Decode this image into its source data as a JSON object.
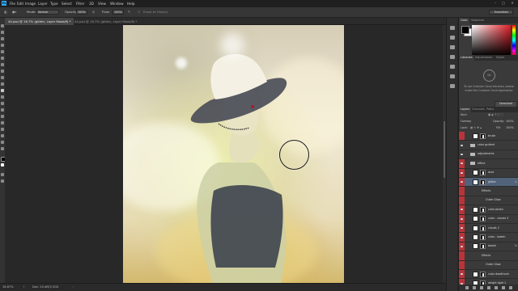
{
  "app": {
    "logo": "Ps",
    "accent": "#31a8ff"
  },
  "menu": [
    "File",
    "Edit",
    "Image",
    "Layer",
    "Type",
    "Select",
    "Filter",
    "3D",
    "View",
    "Window",
    "Help"
  ],
  "window_controls": [
    "–",
    "□",
    "✕"
  ],
  "options_bar": {
    "mode_label": "Mode:",
    "mode_value": "Normal",
    "opacity_label": "Opacity:",
    "opacity_value": "100%",
    "flow_label": "Flow:",
    "flow_value": "100%",
    "history_label": "Erase to History",
    "workspace": "Essentials"
  },
  "tabs": [
    {
      "label": "44.psd @ 16.7% (glitter, Layer Mask/8) *",
      "active": true
    },
    {
      "label": "44.psd @ 16.7% (glitter, Layer Mask/8) *",
      "active": false
    }
  ],
  "status": {
    "zoom": "16.67%",
    "doc": "Doc: 20.4M/2.50G"
  },
  "panels": {
    "color_tabs": [
      "Color",
      "Swatches"
    ],
    "library_tabs": [
      "Libraries",
      "Adjustments",
      "Styles"
    ],
    "cc_message": "To use Creative Cloud Libraries, please install the Creative Cloud Application",
    "cc_button": "Download",
    "layers_tabs": [
      "Layers",
      "Channels",
      "Paths"
    ],
    "kind_label": "Kind",
    "blend_mode": "Overlay",
    "opacity_label": "Opacity:",
    "opacity_value": "100%",
    "lock_label": "Lock:",
    "fill_label": "Fill:",
    "fill_value": "100%"
  },
  "layers": [
    {
      "name": "brush",
      "type": "layer",
      "eye": false,
      "red": true
    },
    {
      "name": "color grdient",
      "type": "group",
      "eye": true,
      "red": false
    },
    {
      "name": "adjustments",
      "type": "group",
      "eye": true,
      "red": false
    },
    {
      "name": "effect",
      "type": "group",
      "eye": true,
      "red": true
    },
    {
      "name": "dust",
      "type": "layer",
      "eye": true,
      "red": true
    },
    {
      "name": "glitter",
      "type": "layer",
      "eye": true,
      "red": true,
      "selected": true,
      "fx": "fx"
    },
    {
      "name": "Effects",
      "type": "sub",
      "eye": false,
      "red": true
    },
    {
      "name": "Outer Glow",
      "type": "sub2",
      "eye": false,
      "red": true
    },
    {
      "name": "color photo",
      "type": "layer",
      "eye": true,
      "red": true
    },
    {
      "name": "color - clouds 3",
      "type": "layer",
      "eye": true,
      "red": true
    },
    {
      "name": "clouds 2",
      "type": "layer",
      "eye": true,
      "red": true
    },
    {
      "name": "color - bokeh",
      "type": "layer",
      "eye": true,
      "red": true
    },
    {
      "name": "bokeh",
      "type": "layer",
      "eye": true,
      "red": true,
      "fx": "fx"
    },
    {
      "name": "Effects",
      "type": "sub",
      "eye": false,
      "red": true
    },
    {
      "name": "Outer Glow",
      "type": "sub2",
      "eye": false,
      "red": true
    },
    {
      "name": "color deadtrunk",
      "type": "layer",
      "eye": true,
      "red": true
    },
    {
      "name": "relight light 1",
      "type": "layer",
      "eye": true,
      "red": true
    }
  ]
}
